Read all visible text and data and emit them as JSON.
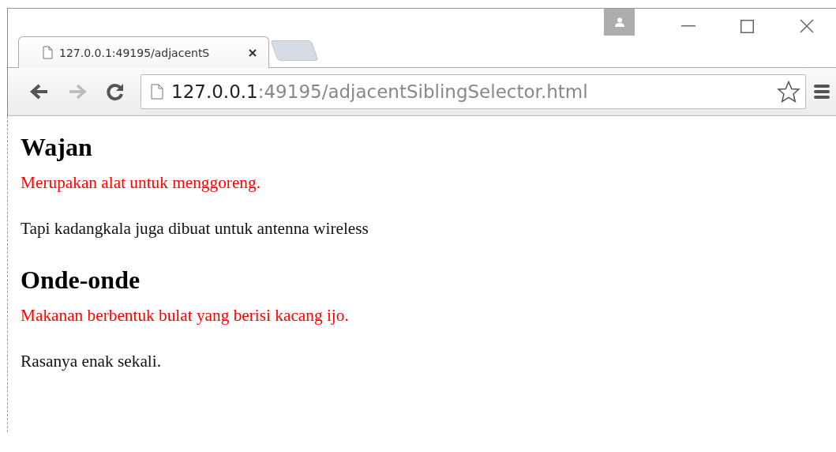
{
  "tabs": [
    {
      "title": "127.0.0.1:49195/adjacentS",
      "selected": true
    }
  ],
  "address": {
    "host": "127.0.0.1",
    "path": ":49195/adjacentSiblingSelector.html"
  },
  "navigation": {
    "back_disabled": false,
    "forward_disabled": true
  },
  "content": [
    {
      "kind": "heading",
      "text": "Wajan"
    },
    {
      "kind": "note",
      "text": "Merupakan alat untuk menggoreng."
    },
    {
      "kind": "text",
      "text": "Tapi kadangkala juga dibuat untuk antenna wireless"
    },
    {
      "kind": "heading",
      "text": "Onde-onde"
    },
    {
      "kind": "note",
      "text": "Makanan berbentuk bulat yang berisi kacang ijo."
    },
    {
      "kind": "text",
      "text": "Rasanya enak sekali."
    }
  ]
}
